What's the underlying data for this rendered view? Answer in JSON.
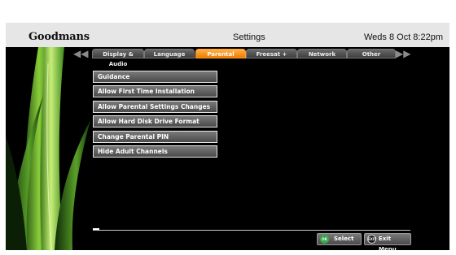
{
  "header": {
    "brand": "Goodmans",
    "title": "Settings",
    "datetime": "Weds 8 Oct  8:22pm"
  },
  "tabs": [
    {
      "label": "Display & Audio",
      "active": false
    },
    {
      "label": "Language",
      "active": false
    },
    {
      "label": "Parental",
      "active": true
    },
    {
      "label": "Freesat +",
      "active": false
    },
    {
      "label": "Network",
      "active": false
    },
    {
      "label": "Other",
      "active": false
    }
  ],
  "menu": {
    "items": [
      "Guidance",
      "Allow First Time Installation",
      "Allow Parental Settings Changes",
      "Allow Hard Disk Drive Format",
      "Change Parental PIN",
      "Hide Adult Channels"
    ]
  },
  "footer": {
    "ok_badge": "OK",
    "select_label": "Select",
    "exit_badge": "EXIT",
    "exit_label": "Exit Menu"
  },
  "colors": {
    "accent": "#f28a10",
    "ok_button": "#3aa84a",
    "background": "#000000"
  },
  "icons": {
    "left_arrow": "double-chevron-left-icon",
    "right_arrow": "double-chevron-right-icon"
  }
}
